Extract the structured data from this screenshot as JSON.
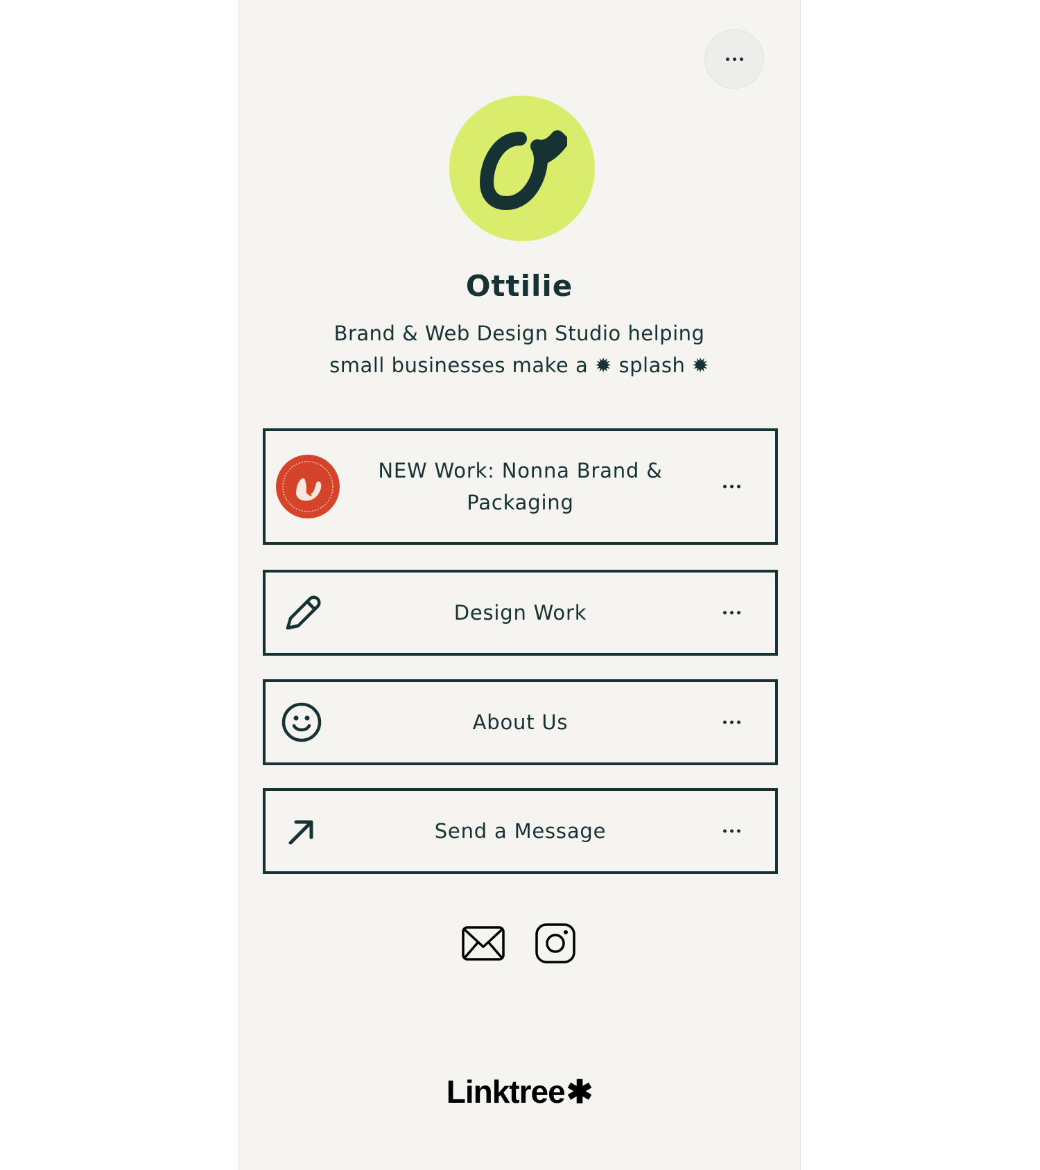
{
  "profile": {
    "name": "Ottilie",
    "avatar_letter": "O",
    "bio": "Brand & Web Design Studio helping small businesses make a ✹ splash ✹"
  },
  "links": [
    {
      "label": "NEW Work: Nonna Brand & Packaging",
      "icon": "nonna-badge-icon"
    },
    {
      "label": "Design Work",
      "icon": "pencil-icon"
    },
    {
      "label": "About Us",
      "icon": "smiley-icon"
    },
    {
      "label": "Send a Message",
      "icon": "arrow-up-right-icon"
    }
  ],
  "socials": [
    "mail-icon",
    "instagram-icon"
  ],
  "footer": {
    "brand": "Linktree",
    "brand_mark": "✱"
  },
  "colors": {
    "page_bg": "#f5f4f1",
    "text": "#163232",
    "avatar_bg": "#d9ec6b",
    "badge": "#d5442a"
  }
}
